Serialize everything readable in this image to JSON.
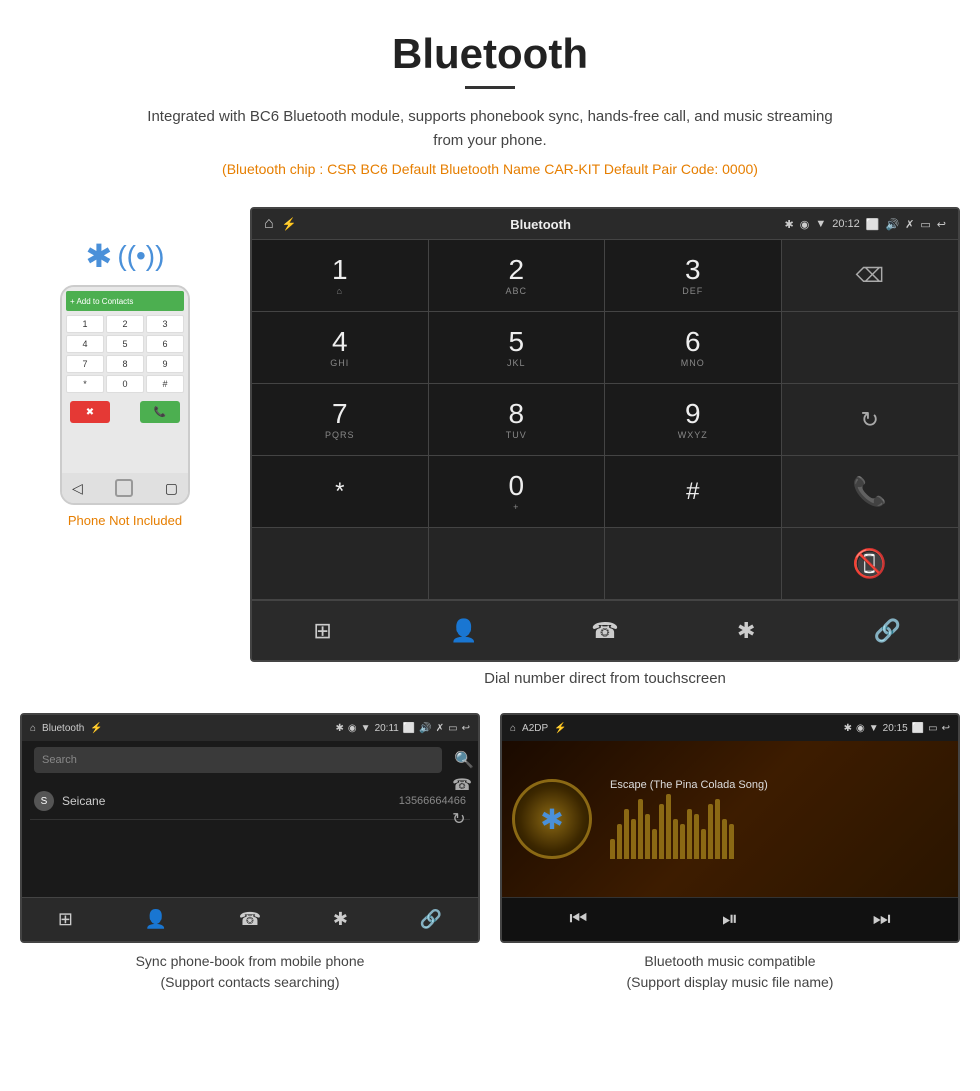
{
  "header": {
    "title": "Bluetooth",
    "description": "Integrated with BC6 Bluetooth module, supports phonebook sync, hands-free call, and music streaming from your phone.",
    "specs": "(Bluetooth chip : CSR BC6    Default Bluetooth Name CAR-KIT    Default Pair Code: 0000)"
  },
  "car_screen": {
    "status_bar": {
      "home": "⌂",
      "title": "Bluetooth",
      "usb": "⚡",
      "time": "20:12",
      "icons": "✳ ◉ ▼ ◻ ▣ ↩"
    },
    "dialpad": [
      {
        "number": "1",
        "letters": "⌂",
        "empty_right": true
      },
      {
        "number": "2",
        "letters": "ABC"
      },
      {
        "number": "3",
        "letters": "DEF"
      },
      {
        "action": "backspace"
      },
      {
        "number": "4",
        "letters": "GHI"
      },
      {
        "number": "5",
        "letters": "JKL"
      },
      {
        "number": "6",
        "letters": "MNO"
      },
      {
        "action": "empty"
      },
      {
        "number": "7",
        "letters": "PQRS"
      },
      {
        "number": "8",
        "letters": "TUV"
      },
      {
        "number": "9",
        "letters": "WXYZ"
      },
      {
        "action": "refresh"
      },
      {
        "number": "*",
        "letters": ""
      },
      {
        "number": "0",
        "letters": "+"
      },
      {
        "number": "#",
        "letters": ""
      },
      {
        "action": "call-green"
      },
      {
        "action": "call-red",
        "colspan": true
      }
    ],
    "bottom_bar_icons": [
      "⊞",
      "👤",
      "☎",
      "✱",
      "🔗"
    ]
  },
  "dial_caption": "Dial number direct from touchscreen",
  "phone_not_included": "Phone Not Included",
  "contacts_panel": {
    "title": "Bluetooth",
    "time": "20:11",
    "search_placeholder": "Search",
    "contacts": [
      {
        "letter": "S",
        "name": "Seicane",
        "phone": "13566664466"
      }
    ],
    "bottom_icons": [
      "⊞",
      "👤",
      "☎",
      "✱",
      "🔗"
    ]
  },
  "contacts_caption": "Sync phone-book from mobile phone\n(Support contacts searching)",
  "music_panel": {
    "title": "A2DP",
    "time": "20:15",
    "song_title": "Escape (The Pina Colada Song)",
    "viz_bars": [
      20,
      35,
      50,
      40,
      60,
      45,
      30,
      55,
      65,
      40,
      35,
      50,
      45,
      30,
      55,
      60,
      40,
      35
    ]
  },
  "music_caption": "Bluetooth music compatible\n(Support display music file name)"
}
